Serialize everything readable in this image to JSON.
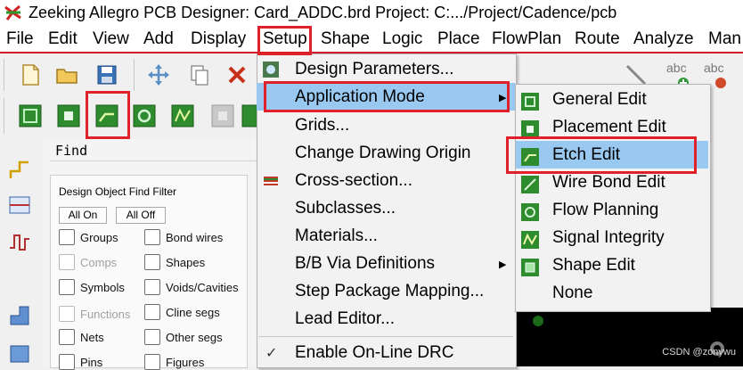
{
  "window": {
    "title": "Zeeking Allegro PCB Designer: Card_ADDC.brd  Project: C:.../Project/Cadence/pcb"
  },
  "menubar": {
    "items": [
      {
        "label": "File"
      },
      {
        "label": "Edit"
      },
      {
        "label": "View"
      },
      {
        "label": "Add"
      },
      {
        "label": "Display"
      },
      {
        "label": "Setup"
      },
      {
        "label": "Shape"
      },
      {
        "label": "Logic"
      },
      {
        "label": "Place"
      },
      {
        "label": "FlowPlan"
      },
      {
        "label": "Route"
      },
      {
        "label": "Analyze"
      },
      {
        "label": "Man"
      }
    ]
  },
  "setup_menu": {
    "items": [
      {
        "label": "Design Parameters..."
      },
      {
        "label": "Application Mode"
      },
      {
        "label": "Grids..."
      },
      {
        "label": "Change Drawing Origin"
      },
      {
        "label": "Cross-section..."
      },
      {
        "label": "Subclasses..."
      },
      {
        "label": "Materials..."
      },
      {
        "label": "B/B Via Definitions"
      },
      {
        "label": "Step Package Mapping..."
      },
      {
        "label": "Lead Editor..."
      },
      {
        "label": "Enable On-Line DRC"
      }
    ],
    "check_mark": "✓"
  },
  "application_mode_submenu": {
    "items": [
      {
        "label": "General Edit"
      },
      {
        "label": "Placement Edit"
      },
      {
        "label": "Etch Edit"
      },
      {
        "label": "Wire Bond Edit"
      },
      {
        "label": "Flow Planning"
      },
      {
        "label": "Signal Integrity"
      },
      {
        "label": "Shape Edit"
      },
      {
        "label": "None"
      }
    ]
  },
  "find_panel": {
    "title": "Find",
    "filter_title": "Design Object Find Filter",
    "all_on": "All On",
    "all_off": "All Off",
    "left_column": [
      {
        "label": "Groups",
        "enabled": true
      },
      {
        "label": "Comps",
        "enabled": false
      },
      {
        "label": "Symbols",
        "enabled": true
      },
      {
        "label": "Functions",
        "enabled": false
      },
      {
        "label": "Nets",
        "enabled": true
      },
      {
        "label": "Pins",
        "enabled": true
      }
    ],
    "right_column": [
      {
        "label": "Bond wires",
        "enabled": true
      },
      {
        "label": "Shapes",
        "enabled": true
      },
      {
        "label": "Voids/Cavities",
        "enabled": true
      },
      {
        "label": "Cline segs",
        "enabled": true
      },
      {
        "label": "Other segs",
        "enabled": true
      },
      {
        "label": "Figures",
        "enabled": true
      }
    ]
  },
  "toolbar_right": {
    "abc_label": "abc"
  },
  "watermark": "CSDN @zonywu",
  "colors": {
    "highlight": "#99c9f0",
    "red_box": "#e0202a",
    "menu_bg": "#f2f2f2",
    "icon_green": "#2e8b2e"
  }
}
